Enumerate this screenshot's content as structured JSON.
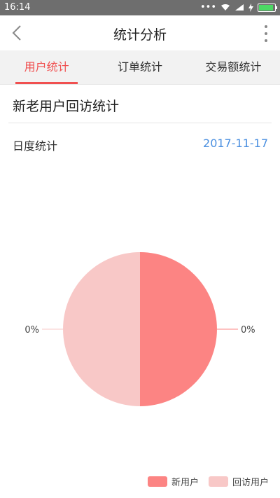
{
  "status": {
    "time": "16:14"
  },
  "header": {
    "title": "统计分析"
  },
  "tabs": [
    {
      "label": "用户统计",
      "active": true
    },
    {
      "label": "订单统计",
      "active": false
    },
    {
      "label": "交易额统计",
      "active": false
    }
  ],
  "section": {
    "title": "新老用户回访统计"
  },
  "period": {
    "label": "日度统计",
    "date": "2017-11-17"
  },
  "colors": {
    "accent": "#f05050",
    "date_link": "#4a8fe0",
    "new_user": "#fc8483",
    "return_user": "#f8c8c7"
  },
  "chart_data": {
    "type": "pie",
    "series": [
      {
        "name": "新用户",
        "value": 0,
        "label": "0%",
        "color": "#fc8483"
      },
      {
        "name": "回访用户",
        "value": 0,
        "label": "0%",
        "color": "#f8c8c7"
      }
    ]
  }
}
